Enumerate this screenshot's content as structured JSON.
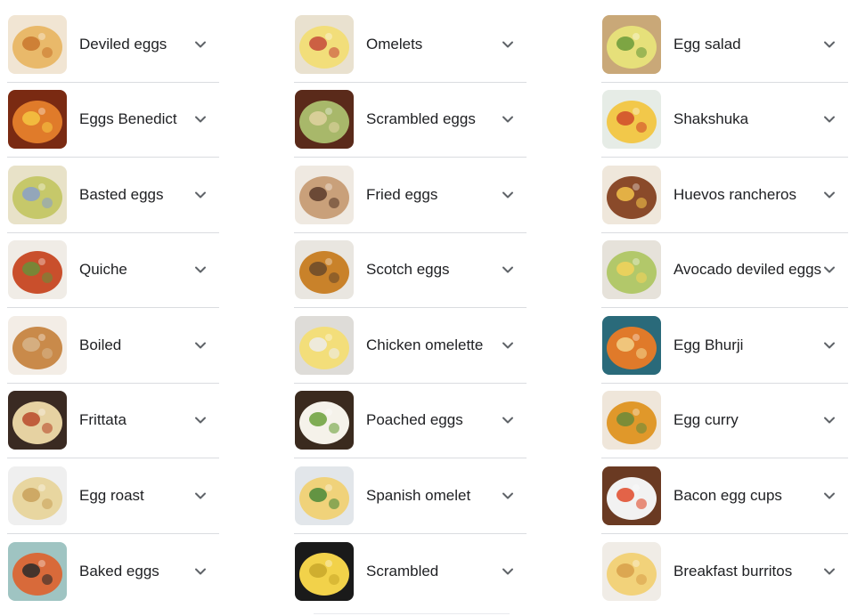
{
  "columns": [
    {
      "items": [
        {
          "label": "Deviled eggs",
          "colors": [
            "#f1e5d3",
            "#e9b96a",
            "#c9762d"
          ]
        },
        {
          "label": "Eggs Benedict",
          "colors": [
            "#7a2a12",
            "#e07b2a",
            "#f5c542"
          ]
        },
        {
          "label": "Basted eggs",
          "colors": [
            "#e8e2c8",
            "#c6c86a",
            "#8aa0c8"
          ]
        },
        {
          "label": "Quiche",
          "colors": [
            "#f0ece6",
            "#c94f2c",
            "#6b8e3a"
          ]
        },
        {
          "label": "Boiled",
          "colors": [
            "#f3ede6",
            "#c98a4a",
            "#d7b48a"
          ]
        },
        {
          "label": "Frittata",
          "colors": [
            "#3a2a22",
            "#e6d2a2",
            "#b84a2a"
          ]
        },
        {
          "label": "Egg roast",
          "colors": [
            "#efefef",
            "#e8d6a0",
            "#c9a15a"
          ]
        },
        {
          "label": "Baked eggs",
          "colors": [
            "#9fc4c2",
            "#d86a3a",
            "#2a2a2a"
          ]
        }
      ]
    },
    {
      "items": [
        {
          "label": "Omelets",
          "colors": [
            "#e9e1cf",
            "#f2de7a",
            "#c64a3a"
          ]
        },
        {
          "label": "Scrambled eggs",
          "colors": [
            "#5a2a1a",
            "#a8b86a",
            "#e0d2a0"
          ]
        },
        {
          "label": "Fried eggs",
          "colors": [
            "#efe9e1",
            "#c9a07a",
            "#5a3a2a"
          ]
        },
        {
          "label": "Scotch eggs",
          "colors": [
            "#e9e6e0",
            "#c9822a",
            "#6a4a2a"
          ]
        },
        {
          "label": "Chicken omelette",
          "colors": [
            "#dedcd8",
            "#f3de7a",
            "#ececec"
          ]
        },
        {
          "label": "Poached eggs",
          "colors": [
            "#3a2a1e",
            "#f5f2ea",
            "#6aa03a"
          ]
        },
        {
          "label": "Spanish omelet",
          "colors": [
            "#e2e6ea",
            "#f0d27a",
            "#4a8a3a"
          ]
        },
        {
          "label": "Scrambled",
          "colors": [
            "#1a1a1a",
            "#f2d24a",
            "#c9a82a"
          ]
        }
      ]
    },
    {
      "items": [
        {
          "label": "Egg salad",
          "colors": [
            "#c9a878",
            "#e6e07a",
            "#6a9a3a"
          ]
        },
        {
          "label": "Shakshuka",
          "colors": [
            "#e6ece6",
            "#f2c84a",
            "#d04a2a"
          ]
        },
        {
          "label": "Huevos rancheros",
          "colors": [
            "#efe7db",
            "#8a4a2a",
            "#f2c24a"
          ]
        },
        {
          "label": "Avocado deviled eggs",
          "colors": [
            "#e6e2da",
            "#b2c86a",
            "#f2d25a"
          ]
        },
        {
          "label": "Egg Bhurji",
          "colors": [
            "#2a6a7a",
            "#e07a2a",
            "#f2d28a"
          ]
        },
        {
          "label": "Egg curry",
          "colors": [
            "#efe6da",
            "#e0982a",
            "#6a8a3a"
          ]
        },
        {
          "label": "Bacon egg cups",
          "colors": [
            "#6a3a22",
            "#f2f2f2",
            "#e04a2a"
          ]
        },
        {
          "label": "Breakfast burritos",
          "colors": [
            "#f0ece6",
            "#f2d27a",
            "#d8a04a"
          ]
        }
      ]
    }
  ],
  "chevron_icon": "chevron-down-icon",
  "accent_chevron_color": "#5f6368"
}
